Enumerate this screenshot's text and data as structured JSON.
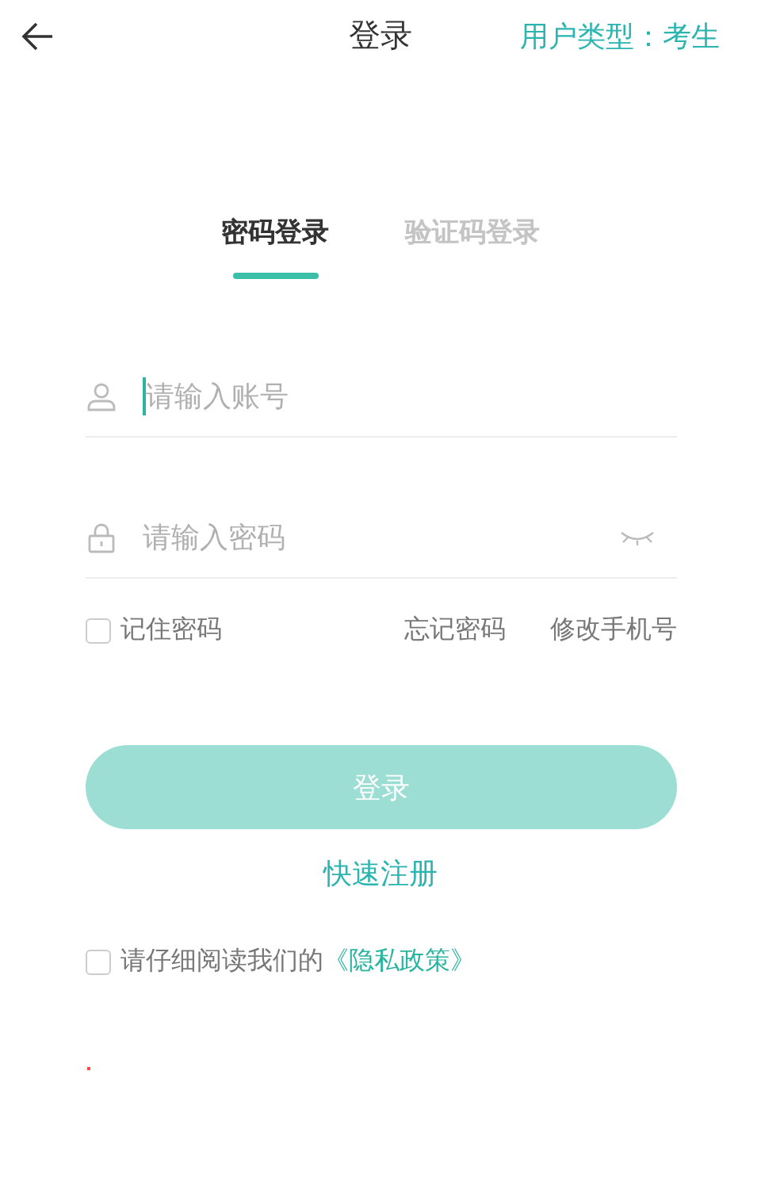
{
  "header": {
    "title": "登录",
    "user_type": "用户类型：考生"
  },
  "tabs": [
    {
      "label": "密码登录",
      "selected": true
    },
    {
      "label": "验证码登录",
      "selected": false
    }
  ],
  "account_field": {
    "placeholder": "请输入账号",
    "focused": true
  },
  "password_field": {
    "placeholder": "请输入密码",
    "focused": false
  },
  "remember": {
    "label": "记住密码",
    "checked": false
  },
  "links": [
    "忘记密码",
    "修改手机号"
  ],
  "login_button": {
    "label": "登录",
    "disabled": true
  },
  "register_link": "快速注册",
  "privacy": {
    "text": "请仔细阅读我们的",
    "link": "《隐私政策》",
    "checked": false
  }
}
